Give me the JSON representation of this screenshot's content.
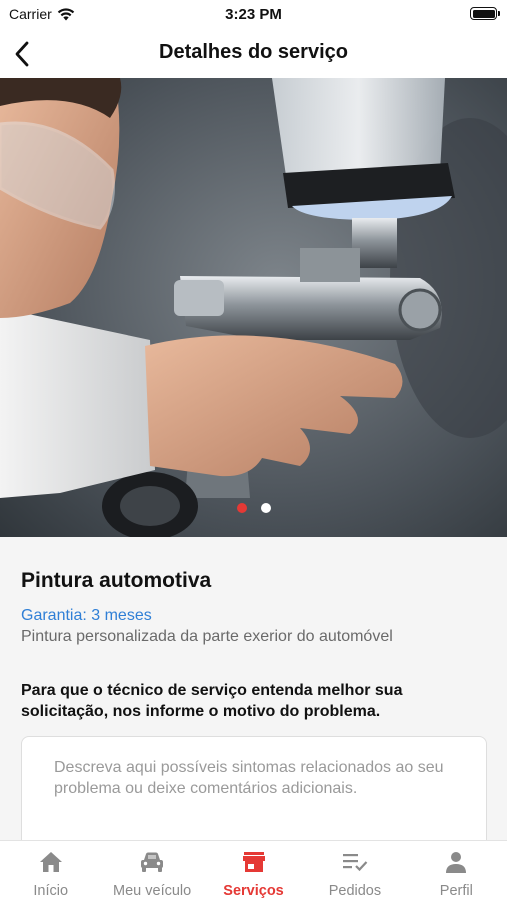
{
  "status_bar": {
    "carrier": "Carrier",
    "time": "3:23 PM"
  },
  "header": {
    "title": "Detalhes do serviço",
    "back_icon": "chevron-left-icon"
  },
  "carousel": {
    "image": "photo of technician holding a paint spray gun",
    "slides": 2,
    "active_index": 0
  },
  "service": {
    "name": "Pintura automotiva",
    "warranty": "Garantia: 3 meses",
    "description": "Pintura personalizada da parte exerior do automóvel"
  },
  "request": {
    "prompt": "Para que o técnico de serviço entenda melhor sua solicitação, nos informe o motivo do problema.",
    "placeholder": "Descreva aqui possíveis sintomas relacionados ao seu problema ou deixe comentários adicionais.",
    "value": ""
  },
  "tabs": [
    {
      "label": "Início",
      "icon": "home-icon",
      "active": false
    },
    {
      "label": "Meu veículo",
      "icon": "car-icon",
      "active": false
    },
    {
      "label": "Serviços",
      "icon": "store-icon",
      "active": true
    },
    {
      "label": "Pedidos",
      "icon": "list-check-icon",
      "active": false
    },
    {
      "label": "Perfil",
      "icon": "person-icon",
      "active": false
    }
  ],
  "colors": {
    "accent": "#e53935",
    "link": "#2f7fd6",
    "inactive": "#8a8a8a"
  }
}
